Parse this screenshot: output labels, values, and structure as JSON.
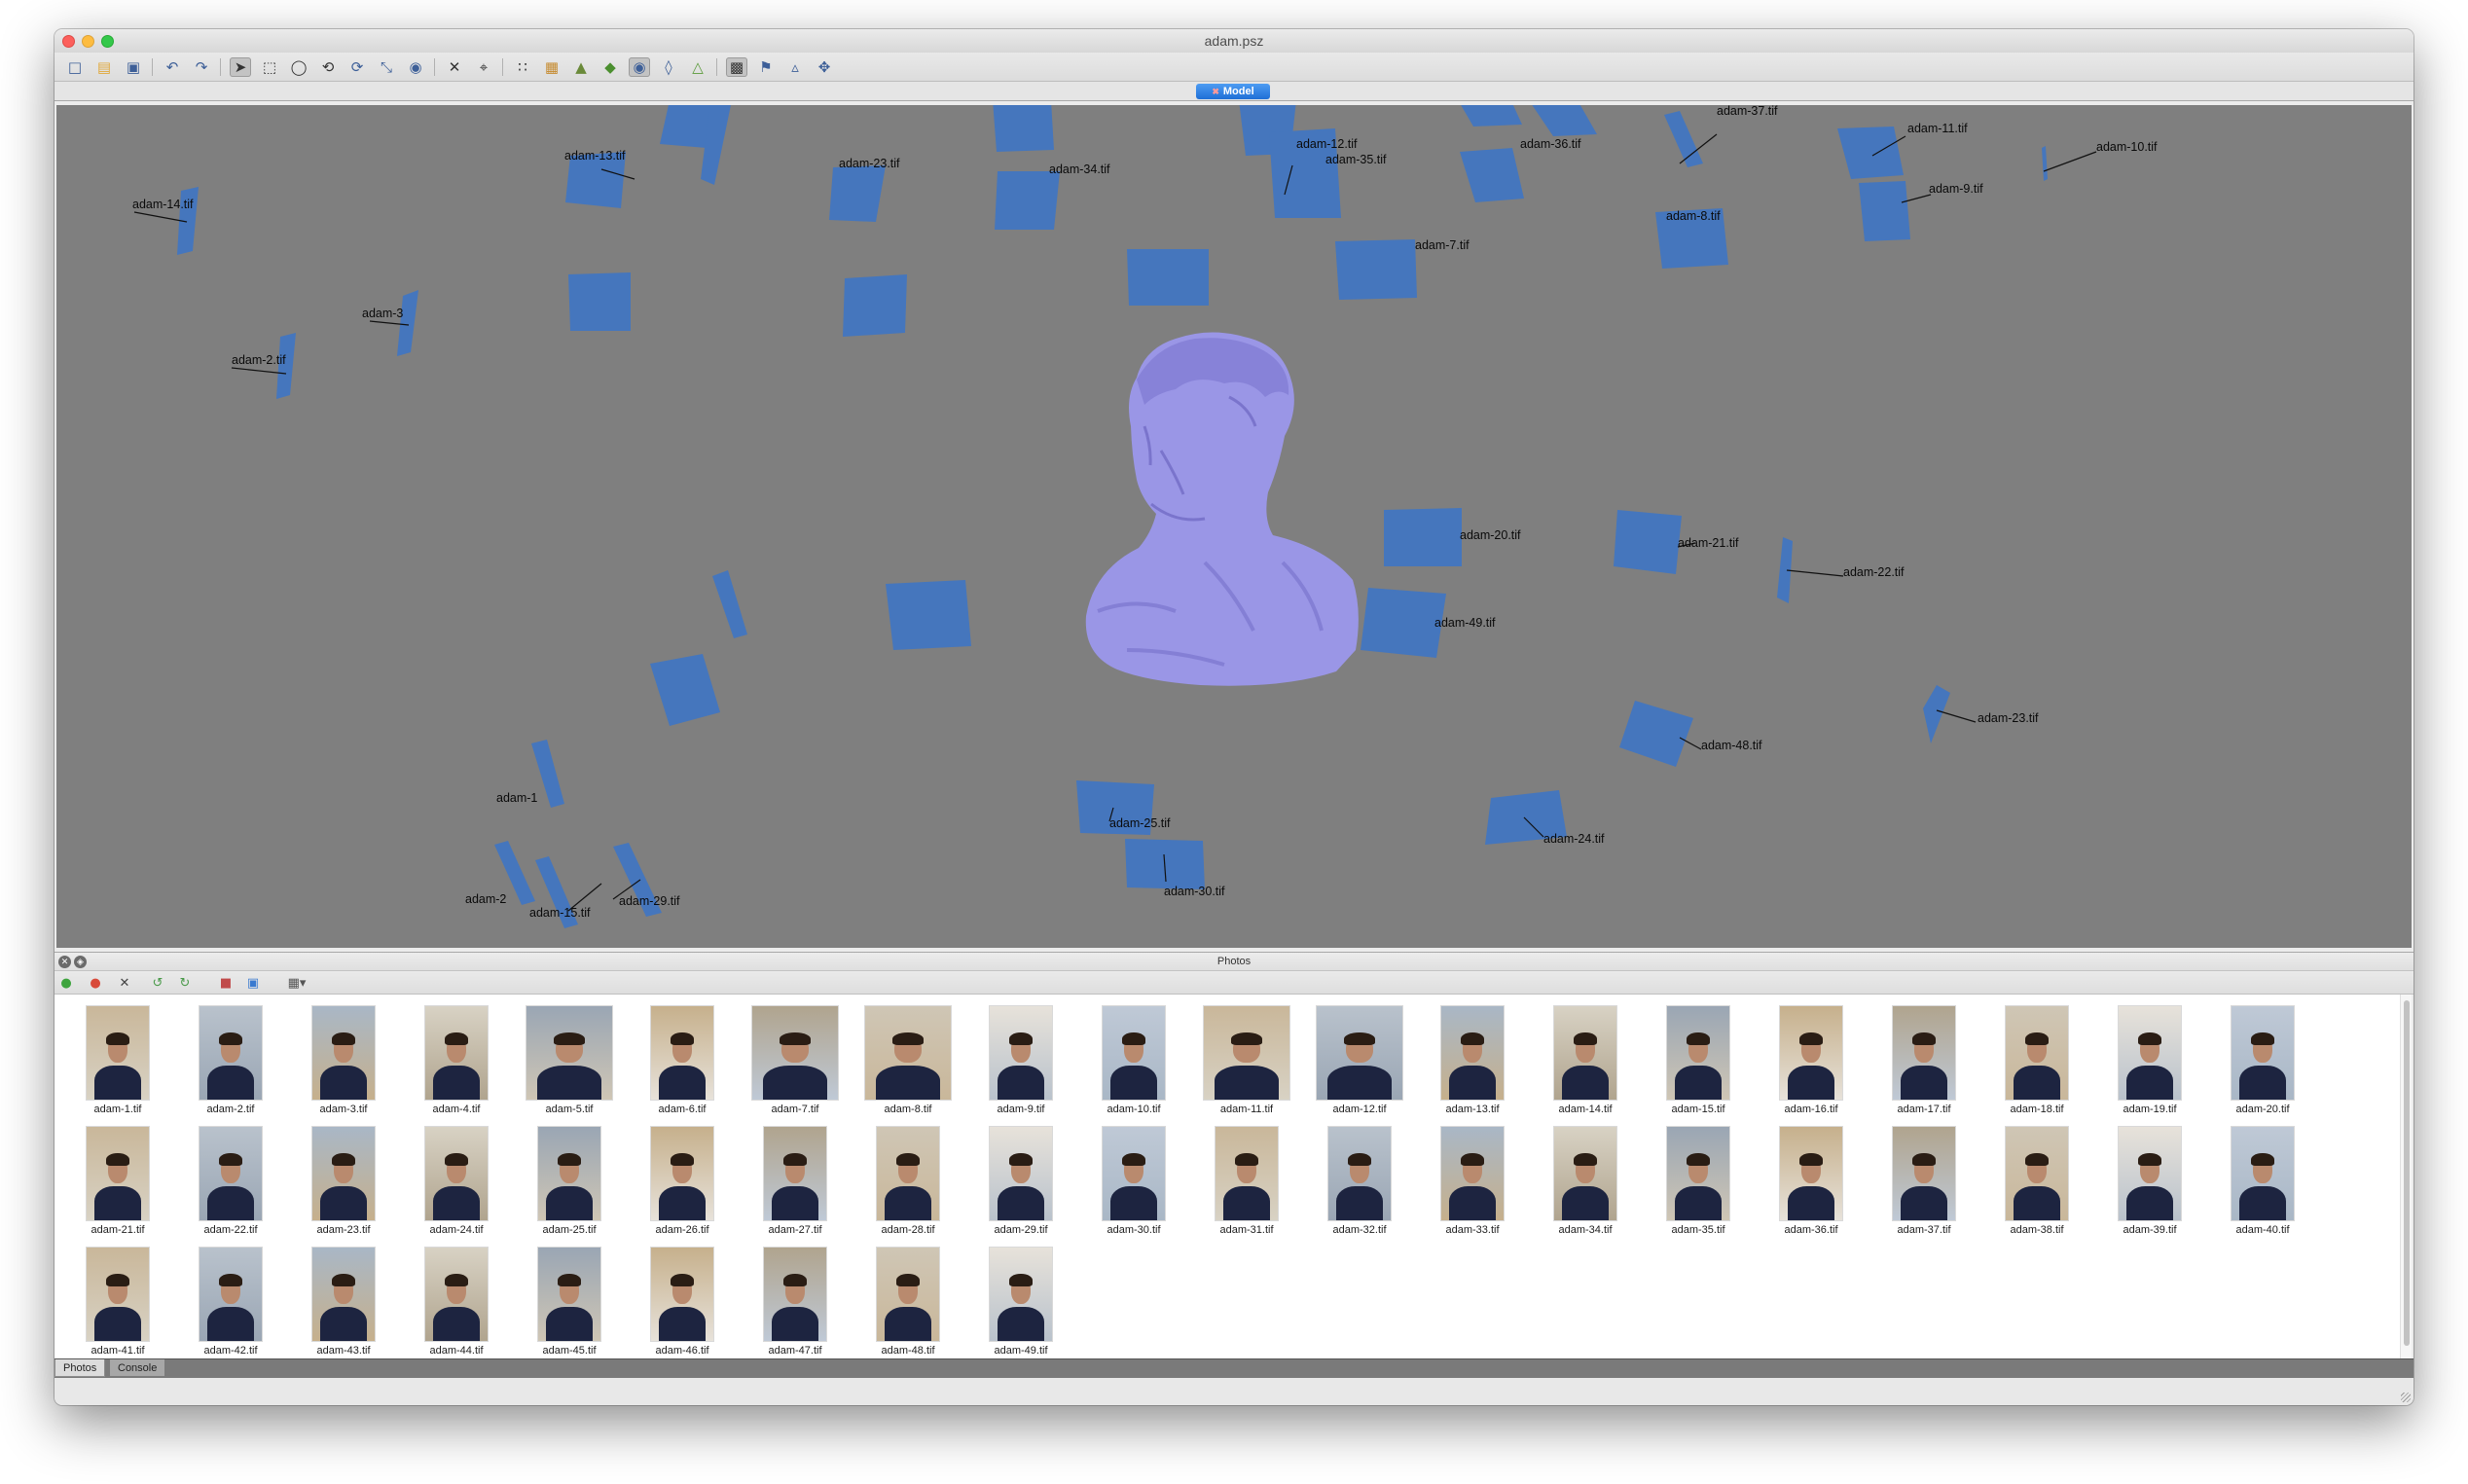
{
  "window": {
    "title": "adam.psz"
  },
  "toolbar": {
    "icons": [
      "new-document-icon",
      "open-folder-icon",
      "save-icon",
      "undo-icon",
      "redo-icon",
      "navigation-icon",
      "rectangle-selection-icon",
      "circle-selection-icon",
      "free-form-selection-icon",
      "rotate-object-icon",
      "resize-region-icon",
      "rotate-region-icon",
      "delete-selection-icon",
      "crop-selection-icon",
      "point-cloud-icon",
      "dense-cloud-icon",
      "solid-model-icon",
      "shaded-model-icon",
      "textured-model-icon",
      "wireframe-icon",
      "tiled-model-icon",
      "show-cameras-icon",
      "show-markers-icon",
      "show-region-icon",
      "reset-view-icon"
    ]
  },
  "model_tab": {
    "label": "Model"
  },
  "viewport": {
    "model_color": "#9a96e6",
    "camera_color": "#4576bd",
    "background": "#7f7f7f",
    "camera_labels": [
      "adam-37.tif",
      "adam-36.tif",
      "adam-11.tif",
      "adam-10.tif",
      "adam-13.tif",
      "adam-12.tif",
      "adam-35.tif",
      "adam-23.tif",
      "adam-34.tif",
      "adam-14.tif",
      "adam-9.tif",
      "adam-8.tif",
      "adam-3",
      "adam-2.tif",
      "adam-21.tif",
      "adam-20.tif",
      "adam-22.tif",
      "adam-49.tif",
      "adam-23.tif",
      "adam-48.tif",
      "adam-25.tif",
      "adam-24.tif",
      "adam-30.tif",
      "adam-15.tif",
      "adam-29.tif",
      "adam-2",
      "adam-1",
      "adam-7.tif"
    ]
  },
  "photos_panel": {
    "title": "Photos",
    "toolbar_icons": [
      "enable-icon",
      "disable-icon",
      "remove-icon",
      "rotate-left-icon",
      "rotate-right-icon",
      "masks-icon",
      "image-quality-icon",
      "view-mode-icon"
    ],
    "photos": [
      "adam-1.tif",
      "adam-2.tif",
      "adam-3.tif",
      "adam-4.tif",
      "adam-5.tif",
      "adam-6.tif",
      "adam-7.tif",
      "adam-8.tif",
      "adam-9.tif",
      "adam-10.tif",
      "adam-11.tif",
      "adam-12.tif",
      "adam-13.tif",
      "adam-14.tif",
      "adam-15.tif",
      "adam-16.tif",
      "adam-17.tif",
      "adam-18.tif",
      "adam-19.tif",
      "adam-20.tif",
      "adam-21.tif",
      "adam-22.tif",
      "adam-23.tif",
      "adam-24.tif",
      "adam-25.tif",
      "adam-26.tif",
      "adam-27.tif",
      "adam-28.tif",
      "adam-29.tif",
      "adam-30.tif",
      "adam-31.tif",
      "adam-32.tif",
      "adam-33.tif",
      "adam-34.tif",
      "adam-35.tif",
      "adam-36.tif",
      "adam-37.tif",
      "adam-38.tif",
      "adam-39.tif",
      "adam-40.tif",
      "adam-41.tif",
      "adam-42.tif",
      "adam-43.tif",
      "adam-44.tif",
      "adam-45.tif",
      "adam-46.tif",
      "adam-47.tif",
      "adam-48.tif",
      "adam-49.tif"
    ]
  },
  "bottom_tabs": {
    "photos": "Photos",
    "console": "Console"
  }
}
